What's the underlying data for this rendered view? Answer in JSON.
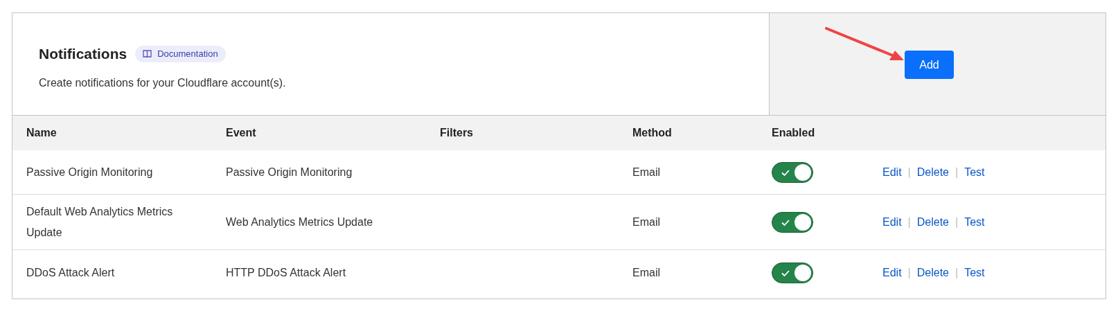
{
  "header": {
    "title": "Notifications",
    "badge": "Documentation",
    "description": "Create notifications for your Cloudflare account(s).",
    "add_button": "Add"
  },
  "table": {
    "columns": [
      "Name",
      "Event",
      "Filters",
      "Method",
      "Enabled"
    ],
    "rows": [
      {
        "name": "Passive Origin Monitoring",
        "event": "Passive Origin Monitoring",
        "method": "Email",
        "enabled": true,
        "actions": [
          "Edit",
          "Delete",
          "Test"
        ],
        "separator": "|"
      },
      {
        "name": "Default Web Analytics Metrics Update",
        "event": "Web Analytics Metrics Update",
        "method": "Email",
        "enabled": true,
        "actions": [
          "Edit",
          "Delete",
          "Test"
        ],
        "separator": "|"
      },
      {
        "name": "DDoS Attack Alert",
        "event": "HTTP DDoS Attack Alert",
        "method": "Email",
        "enabled": true,
        "actions": [
          "Edit",
          "Delete",
          "Test"
        ],
        "separator": "|"
      }
    ]
  }
}
